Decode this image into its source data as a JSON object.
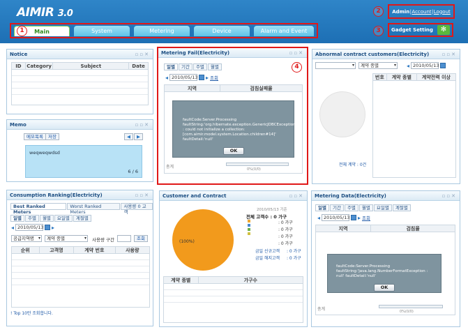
{
  "app": {
    "logo_main": "AIMIR",
    "logo_version": "3.0"
  },
  "tabs": [
    {
      "label": "Main",
      "active": true
    },
    {
      "label": "System",
      "active": false
    },
    {
      "label": "Metering",
      "active": false
    },
    {
      "label": "Device",
      "active": false
    },
    {
      "label": "Alarm and Event",
      "active": false
    }
  ],
  "user": {
    "name": "Admin",
    "account": "Account",
    "logout": "Logout"
  },
  "gadget_setting": "Gadget Setting",
  "callouts": [
    "1",
    "2",
    "3",
    "4"
  ],
  "notice": {
    "title": "Notice",
    "columns": [
      "ID",
      "Category",
      "Subject",
      "Date"
    ]
  },
  "memo": {
    "title": "Memo",
    "btn_list": "메모목록",
    "btn_save": "저장",
    "text": "weqweqwdsd",
    "page": "6 / 6"
  },
  "metering_fail": {
    "title": "Metering Fail(Electricity)",
    "tabs": [
      "일별",
      "기간",
      "주별",
      "월별"
    ],
    "date": "2010/05/13",
    "search": "조회",
    "columns": [
      "지역",
      "검침실패율"
    ],
    "footer_left": "총계",
    "footer_right": "0%(0/0)",
    "dialog_text": "faultCode:Server.Processing faultString:'org.hibernate.exception.GenericJDBCException : could not initialize a collection: [com.aimir.model.system.Location.children#14]' faultDetail:'null'",
    "ok": "OK"
  },
  "abnormal": {
    "title": "Abnormal contract customers(Electricity)",
    "select2": "계약 종별",
    "date": "2010/05/13",
    "columns": [
      "번호",
      "계약 종별",
      "계약전력 이상"
    ],
    "total_label": "전체 계약 : 0건"
  },
  "consumption": {
    "title": "Consumption Ranking(Electricity)",
    "tabs": [
      "Best Ranked Meters",
      "Worst Ranked Meters",
      "사용량 0 고객"
    ],
    "subtabs": [
      "일별",
      "주별",
      "월별",
      "요일별",
      "계절별"
    ],
    "date": "2010/05/13",
    "select1": "공급지역명",
    "select2": "계약 종별",
    "range_label": "사용량 구간",
    "search": "조회",
    "columns": [
      "순위",
      "고객명",
      "계약 번호",
      "사용량"
    ],
    "footer": "! Top 10만 조회합니다."
  },
  "customer": {
    "title": "Customer and Contract",
    "date_label": "2010/05/13 기준",
    "total_label": "전체 고객수",
    "total_value": ": 0 가구",
    "rows": [
      ": 0 가구",
      ": 0 가구",
      ": 0 가구",
      ": 0 가구"
    ],
    "new_label": "금일 신규고객",
    "new_value": ": 0 가구",
    "cancel_label": "금일 해지고객",
    "cancel_value": ": 0 가구",
    "pie_label": "(100%)",
    "columns": [
      "계약 종별",
      "가구수"
    ],
    "legend_colors": [
      "#f0a830",
      "#4a8ad0",
      "#6ab04c",
      "#d0c040"
    ],
    "chart_data": {
      "type": "pie",
      "values": [
        100
      ],
      "labels": [
        "(100%)"
      ]
    }
  },
  "metering_data": {
    "title": "Metering Data(Electricity)",
    "tabs": [
      "일별",
      "기간",
      "주별",
      "월별",
      "요일별",
      "계절별"
    ],
    "date": "2010/05/13",
    "search": "조회",
    "columns": [
      "지역",
      "검침율"
    ],
    "footer_left": "총계",
    "footer_right": "0%(0/0)",
    "dialog_text": "faultCode:Server.Processing faultString:'java.lang.NumberFormatException : null' faultDetail:'null'",
    "ok": "OK"
  }
}
